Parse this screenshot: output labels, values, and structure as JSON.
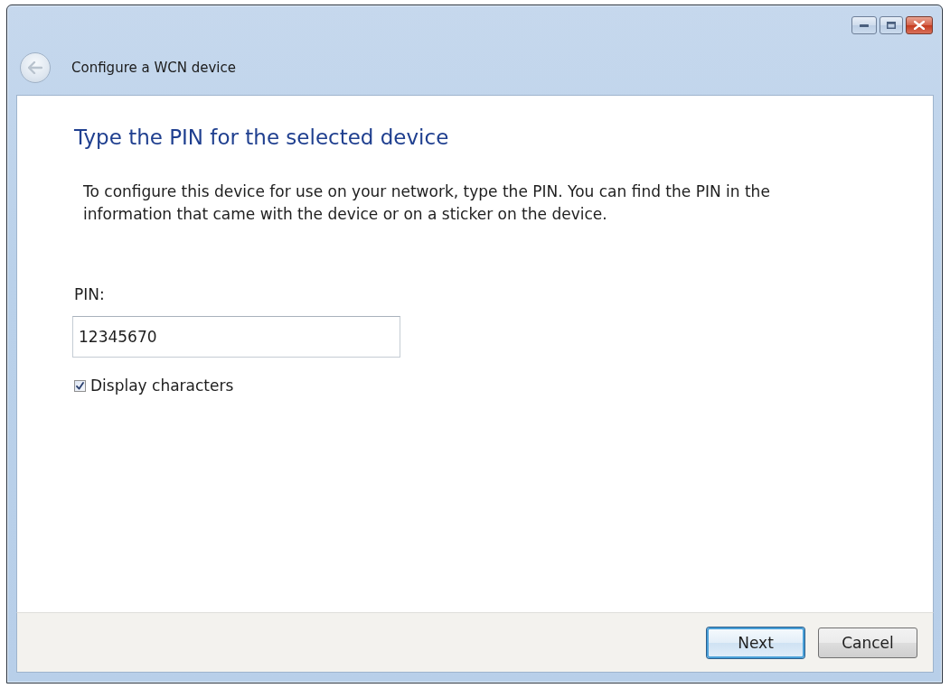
{
  "window": {
    "title": "Configure a WCN device",
    "back_button": {
      "disabled": true
    }
  },
  "page": {
    "heading": "Type the PIN for the selected device",
    "description": "To configure this device for use on your network, type the PIN. You can find the PIN in the information that came with the device or on a sticker on the device.",
    "pin_field": {
      "label": "PIN:",
      "value": "12345670"
    },
    "display_characters": {
      "label": "Display characters",
      "checked": true
    }
  },
  "buttons": [
    {
      "label": "Next",
      "default": true
    },
    {
      "label": "Cancel",
      "default": false
    }
  ]
}
